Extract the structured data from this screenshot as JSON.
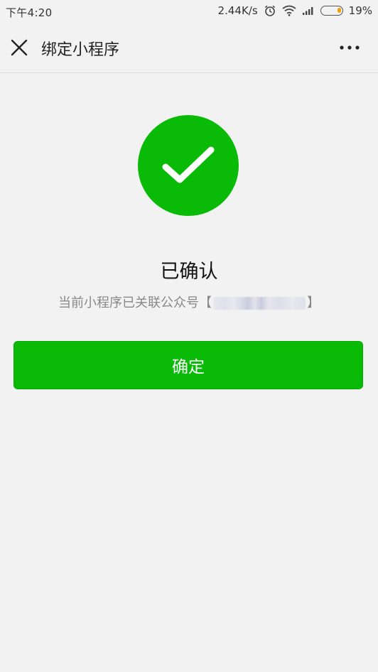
{
  "status_bar": {
    "time": "下午4:20",
    "network_speed": "2.44K/s",
    "battery_percent": "19%",
    "battery_level": 0.19,
    "icons": [
      "alarm-icon",
      "wifi-icon",
      "signal-icon",
      "battery-icon"
    ]
  },
  "nav": {
    "title": "绑定小程序",
    "close_icon": "close-icon",
    "more_icon": "more-dots-icon"
  },
  "result": {
    "icon": "checkmark-icon",
    "title": "已确认",
    "description_prefix": "当前小程序已关联公众号",
    "bracket_open": "【",
    "bracket_close": "】"
  },
  "actions": {
    "confirm_label": "确定"
  },
  "colors": {
    "accent_green": "#09bb07",
    "background": "#f2f2f2",
    "battery_orange": "#f5a000"
  }
}
